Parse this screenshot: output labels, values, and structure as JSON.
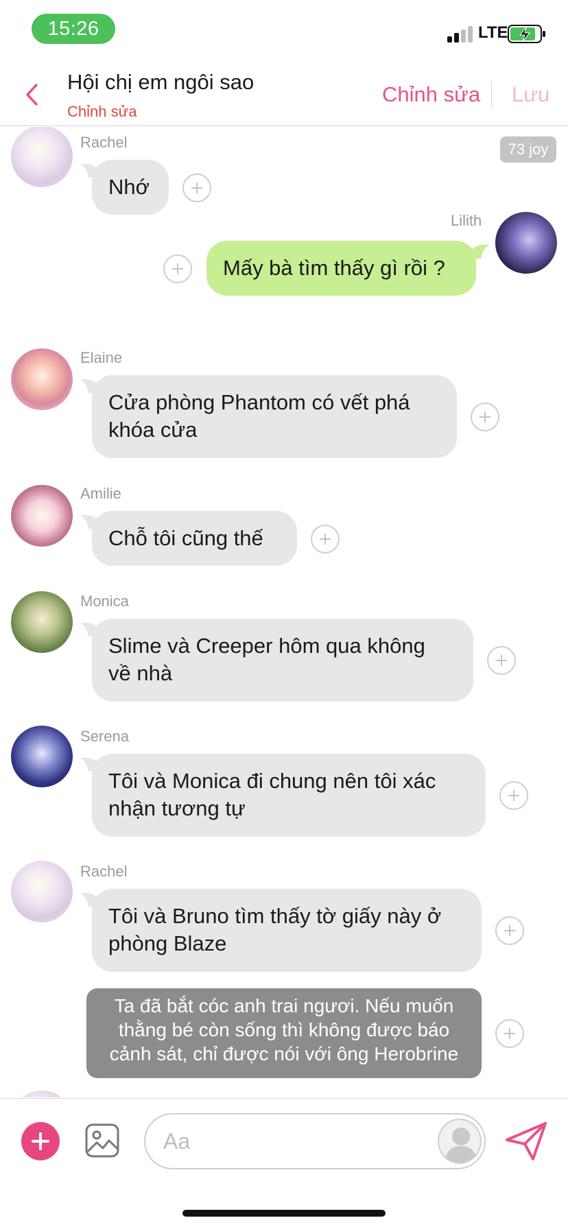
{
  "status_bar": {
    "time": "15:26",
    "network": "LTE",
    "signal_bars": 2,
    "signal_max": 4,
    "battery_charging": true
  },
  "header": {
    "title": "Hội chị em ngôi sao",
    "subtitle": "Chỉnh sửa",
    "edit_label": "Chỉnh sửa",
    "save_label": "Lưu"
  },
  "colors": {
    "accent_pink": "#e8528a",
    "subtitle_red": "#e8433d",
    "incoming_bubble": "#e6e7e9",
    "outgoing_bubble": "#c6ee92",
    "note_bubble": "#8c8c8c",
    "time_pill": "#4cc05a"
  },
  "joy_badge": "73 joy",
  "messages": [
    {
      "sender": "Rachel",
      "text": "Nhớ",
      "side": "left"
    },
    {
      "sender": "Lilith",
      "text": "Mấy bà tìm thấy gì rồi ?",
      "side": "right"
    },
    {
      "sender": "Elaine",
      "lines": [
        "Cửa phòng Phantom có vết phá",
        "khóa cửa"
      ],
      "side": "left"
    },
    {
      "sender": "Amilie",
      "text": "Chỗ tôi cũng thế",
      "side": "left"
    },
    {
      "sender": "Monica",
      "lines": [
        "Slime và Creeper hôm qua không",
        "về nhà"
      ],
      "side": "left"
    },
    {
      "sender": "Serena",
      "lines": [
        "Tôi và Monica đi chung nên tôi xác",
        "nhận tương tự"
      ],
      "side": "left"
    },
    {
      "sender": "Rachel",
      "lines": [
        "Tôi và Bruno tìm thấy tờ giấy này ở",
        "phòng Blaze"
      ],
      "side": "left"
    },
    {
      "lines": [
        "Ta đã bắt cóc anh trai ngươi. Nếu muốn",
        "thằng bé còn sống thì không được báo",
        "cảnh sát, chỉ được nói với ông Herobrine"
      ],
      "side": "left",
      "style": "note"
    }
  ],
  "input": {
    "placeholder": "Aa"
  },
  "icons": {
    "back": "chevron-left-icon",
    "add": "plus-icon",
    "image": "image-icon",
    "send": "send-icon",
    "react": "plus-circle-icon"
  }
}
